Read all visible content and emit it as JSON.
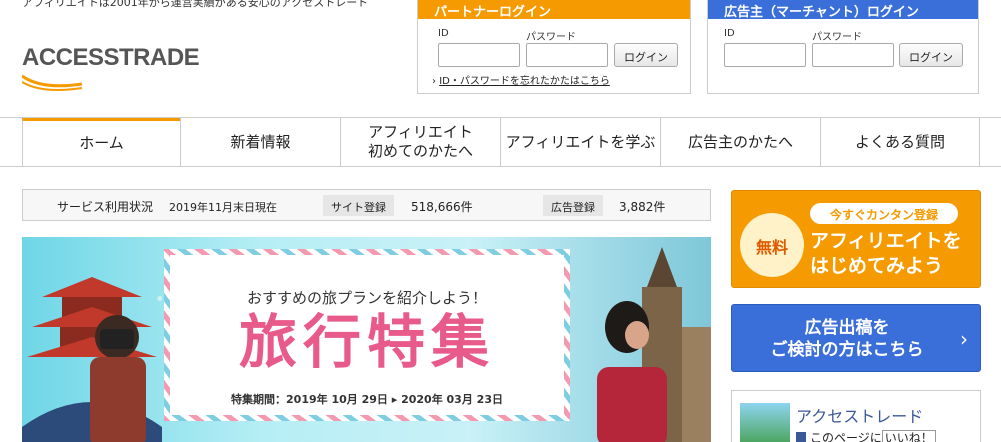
{
  "header": {
    "tagline": "アフィリエイトは2001年から運営実績がある安心のアクセストレード",
    "logo_text": "ACCESSTRADE"
  },
  "partner_login": {
    "title": "パートナーログイン",
    "id_label": "ID",
    "password_label": "パスワード",
    "button": "ログイン",
    "forgot": "ID・パスワードを忘れたかたはこちら"
  },
  "merchant_login": {
    "title": "広告主（マーチャント）ログイン",
    "id_label": "ID",
    "password_label": "パスワード",
    "button": "ログイン"
  },
  "nav": {
    "items": [
      {
        "label": "ホーム"
      },
      {
        "label": "新着情報"
      },
      {
        "label": "アフィリエイト\n初めてのかたへ"
      },
      {
        "label": "アフィリエイトを学ぶ"
      },
      {
        "label": "広告主のかたへ"
      },
      {
        "label": "よくある質問"
      }
    ]
  },
  "stats": {
    "label": "サービス利用状況",
    "as_of": "2019年11月末日現在",
    "site_label": "サイト登録",
    "site_value": "518,666件",
    "ad_label": "広告登録",
    "ad_value": "3,882件"
  },
  "banner": {
    "subtitle": "おすすめの旅プランを紹介しよう！",
    "title": "旅行特集",
    "period": "特集期間：2019年 10月 29日 ▸ 2020年 03月 23日"
  },
  "cta_free": {
    "badge": "無料",
    "pill": "今すぐカンタン登録",
    "main": "アフィリエイトを\nはじめてみよう"
  },
  "cta_ad": {
    "main": "広告出稿を\nご検討の方はこちら",
    "arrow": "›"
  },
  "facebook": {
    "name": "アクセストレード",
    "like_text": "このページに",
    "like_button": "いいね！"
  },
  "colors": {
    "partner": "#f59a00",
    "merchant": "#3a6ed8",
    "accent_pink": "#e85a8a"
  }
}
